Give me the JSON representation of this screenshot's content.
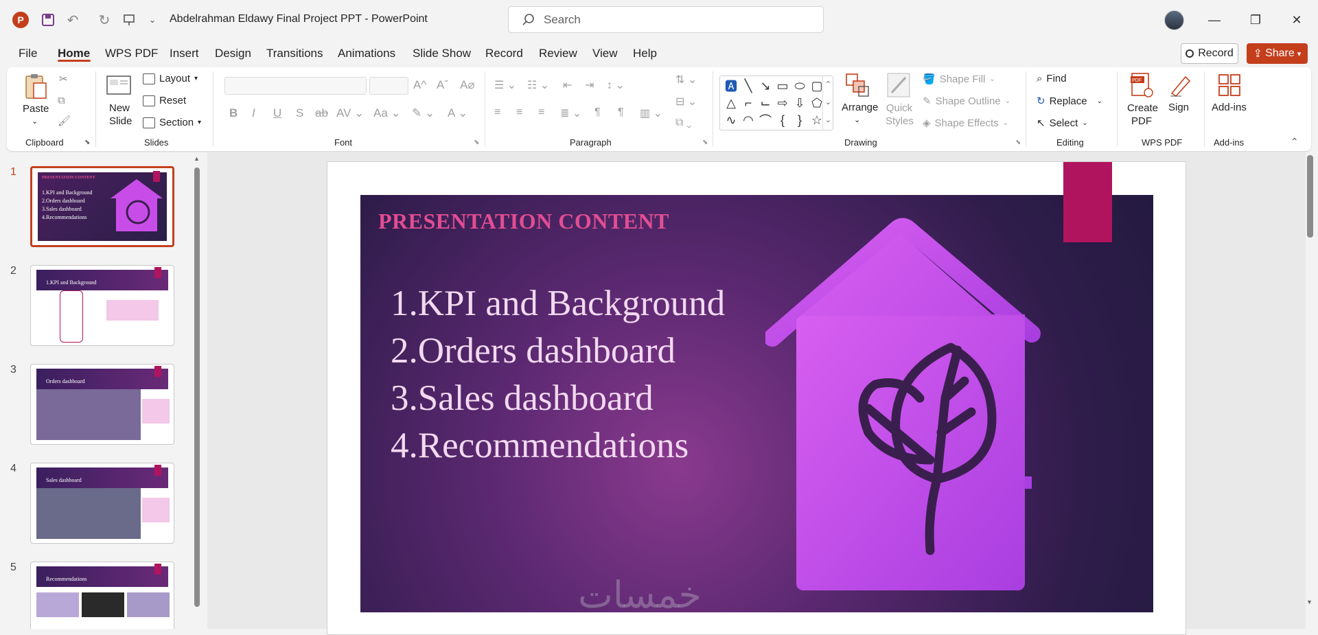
{
  "window": {
    "title": "Abdelrahman Eldawy Final Project PPT  -  PowerPoint",
    "search_placeholder": "Search",
    "app_letter": "P"
  },
  "tabs": [
    "File",
    "Home",
    "WPS PDF",
    "Insert",
    "Design",
    "Transitions",
    "Animations",
    "Slide Show",
    "Record",
    "Review",
    "View",
    "Help"
  ],
  "actions": {
    "record": "Record",
    "share": "Share"
  },
  "ribbon": {
    "clipboard": {
      "paste": "Paste",
      "label": "Clipboard"
    },
    "slides": {
      "new_slide": "New Slide",
      "layout": "Layout",
      "reset": "Reset",
      "section": "Section",
      "label": "Slides"
    },
    "font": {
      "label": "Font"
    },
    "paragraph": {
      "label": "Paragraph"
    },
    "drawing": {
      "arrange": "Arrange",
      "quick_styles": "Quick Styles",
      "shape_fill": "Shape Fill",
      "shape_outline": "Shape Outline",
      "shape_effects": "Shape Effects",
      "label": "Drawing"
    },
    "editing": {
      "find": "Find",
      "replace": "Replace",
      "select": "Select",
      "label": "Editing"
    },
    "wps": {
      "create_pdf": "Create PDF",
      "sign": "Sign",
      "label": "WPS PDF"
    },
    "addins": {
      "addins": "Add-ins",
      "label": "Add-ins"
    }
  },
  "thumbnails": [
    {
      "num": "1",
      "title": "PRESENTATION CONTENT",
      "lines": [
        "1.KPI and Background",
        "2.Orders dashboard",
        "3.Sales dashboard",
        "4.Recommendations"
      ]
    },
    {
      "num": "2",
      "title": "1.KPI and Background"
    },
    {
      "num": "3",
      "title": "Orders dashboard"
    },
    {
      "num": "4",
      "title": "Sales dashboard"
    },
    {
      "num": "5",
      "title": "Recommendations"
    }
  ],
  "slide": {
    "title": "PRESENTATION CONTENT",
    "items": [
      "1.KPI and Background",
      "2.Orders dashboard",
      "3.Sales dashboard",
      "4.Recommendations"
    ],
    "watermark": "خمسات"
  },
  "colors": {
    "accent": "#c43e1c",
    "slide_title": "#e24d93",
    "bookmark": "#b0145e",
    "house": "#c84de8"
  }
}
